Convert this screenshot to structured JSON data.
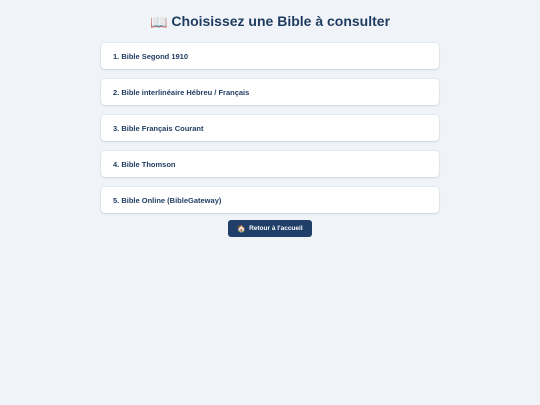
{
  "title": {
    "icon": "open-book-icon",
    "icon_glyph": "📖",
    "text": "Choisissez une Bible à consulter"
  },
  "bibles": [
    {
      "label": "1. Bible Segond 1910"
    },
    {
      "label": "2. Bible interlinéaire Hébreu / Français"
    },
    {
      "label": "3. Bible Français Courant"
    },
    {
      "label": "4. Bible Thomson"
    },
    {
      "label": "5. Bible Online (BibleGateway)"
    }
  ],
  "back_button": {
    "icon": "home-icon",
    "icon_glyph": "🏠",
    "label": "Retour à l'accueil"
  },
  "colors": {
    "background": "#f0f4f8",
    "title": "#1f3b5f",
    "card": "#ffffff",
    "button": "#1f3f68"
  }
}
